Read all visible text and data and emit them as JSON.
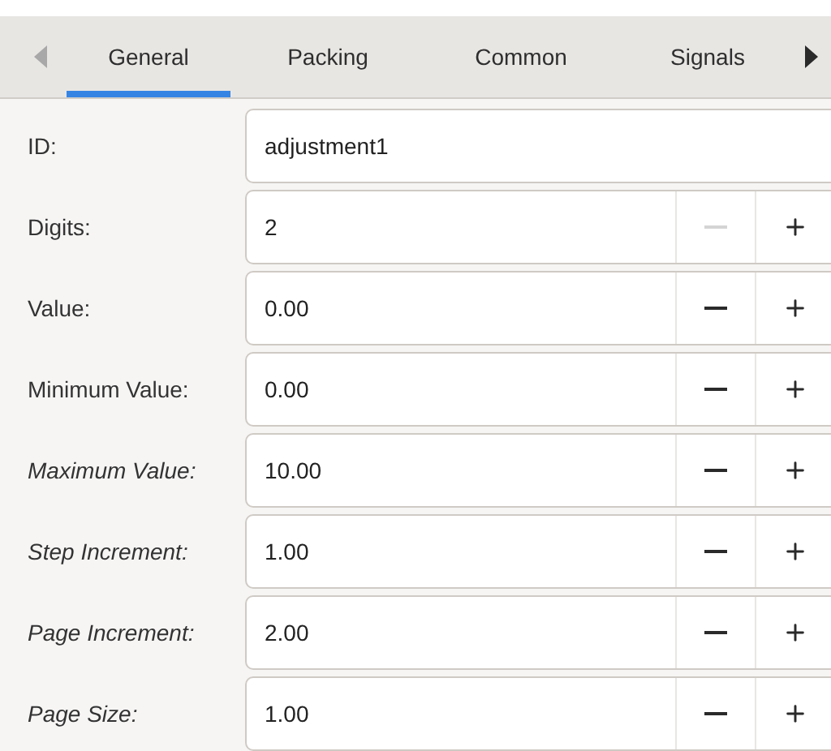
{
  "tabs": [
    {
      "label": "General",
      "selected": true
    },
    {
      "label": "Packing",
      "selected": false
    },
    {
      "label": "Common",
      "selected": false
    },
    {
      "label": "Signals",
      "selected": false
    }
  ],
  "scroll_left": {
    "disabled": true
  },
  "scroll_right": {
    "disabled": false
  },
  "properties": [
    {
      "kind": "text",
      "label": "ID:",
      "italic": false,
      "value": "adjustment1"
    },
    {
      "kind": "spin",
      "label": "Digits:",
      "italic": false,
      "value": "2",
      "decrease_disabled": true,
      "increase_disabled": false
    },
    {
      "kind": "spin",
      "label": "Value:",
      "italic": false,
      "value": "0.00",
      "decrease_disabled": false,
      "increase_disabled": false
    },
    {
      "kind": "spin",
      "label": "Minimum Value:",
      "italic": false,
      "value": "0.00",
      "decrease_disabled": false,
      "increase_disabled": false
    },
    {
      "kind": "spin",
      "label": "Maximum Value:",
      "italic": true,
      "value": "10.00",
      "decrease_disabled": false,
      "increase_disabled": false
    },
    {
      "kind": "spin",
      "label": "Step Increment:",
      "italic": true,
      "value": "1.00",
      "decrease_disabled": false,
      "increase_disabled": false
    },
    {
      "kind": "spin",
      "label": "Page Increment:",
      "italic": true,
      "value": "2.00",
      "decrease_disabled": false,
      "increase_disabled": false
    },
    {
      "kind": "spin",
      "label": "Page Size:",
      "italic": true,
      "value": "1.00",
      "decrease_disabled": false,
      "increase_disabled": false
    }
  ]
}
